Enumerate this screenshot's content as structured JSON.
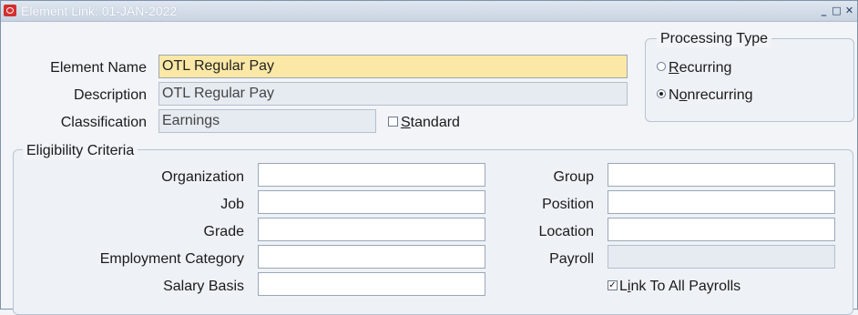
{
  "window": {
    "title": "Element Link: 01-JAN-2022",
    "controls": [
      "minimize",
      "maximize",
      "close"
    ]
  },
  "element": {
    "name_label": "Element Name",
    "name_value": "OTL Regular Pay",
    "description_label": "Description",
    "description_value": "OTL Regular Pay",
    "classification_label": "Classification",
    "classification_value": "Earnings",
    "standard_label_rest": "tandard",
    "standard_label_access": "S",
    "standard_checked": false
  },
  "processing_type": {
    "title": "Processing Type",
    "options": [
      {
        "access": "R",
        "rest": "ecurring",
        "selected": false
      },
      {
        "pre": "N",
        "access": "o",
        "rest": "nrecurring",
        "selected": true
      }
    ]
  },
  "eligibility": {
    "title": "Eligibility Criteria",
    "left": [
      {
        "label": "Organization",
        "value": ""
      },
      {
        "label": "Job",
        "value": ""
      },
      {
        "label": "Grade",
        "value": ""
      },
      {
        "label": "Employment Category",
        "value": ""
      },
      {
        "label": "Salary Basis",
        "value": ""
      }
    ],
    "right": [
      {
        "label": "Group",
        "value": ""
      },
      {
        "label": "Position",
        "value": ""
      },
      {
        "label": "Location",
        "value": ""
      },
      {
        "label": "Payroll",
        "value": ""
      }
    ],
    "link_all_payrolls": {
      "pre": "L",
      "access": "i",
      "rest": "nk To All Payrolls",
      "checked": true
    }
  }
}
